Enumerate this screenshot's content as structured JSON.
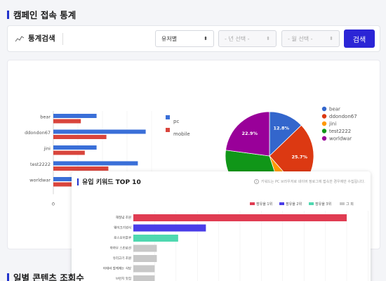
{
  "page": {
    "title": "캠페인 접속 통계",
    "bottom_title": "일별 콘텐츠 조회수"
  },
  "search": {
    "label": "통계검색",
    "user_select": "유저별",
    "year_select": "- 년 선택 -",
    "month_select": "- 월 선택 -",
    "button": "검색"
  },
  "colors": {
    "accent": "#2b25d6",
    "pc": "#3a6fd8",
    "mobile": "#d9453c"
  },
  "chart_data": [
    {
      "type": "bar",
      "orientation": "horizontal",
      "categories": [
        "bear",
        "ddondon67",
        "jini",
        "test2222",
        "worldwar"
      ],
      "series": [
        {
          "name": "pc",
          "values": [
            22,
            47,
            22,
            43,
            20
          ],
          "color": "#3a6fd8"
        },
        {
          "name": "mobile",
          "values": [
            14,
            27,
            16,
            28,
            13
          ],
          "color": "#d9453c"
        }
      ],
      "xlim": [
        0,
        50
      ],
      "tick_labels": [
        "0"
      ],
      "legend": "right"
    },
    {
      "type": "pie",
      "slices": [
        {
          "name": "bear",
          "value": 12.8,
          "label": "12.8%",
          "color": "#3366cc"
        },
        {
          "name": "ddondon67",
          "value": 25.7,
          "label": "25.7%",
          "color": "#dc3912"
        },
        {
          "name": "jini",
          "value": 6.5,
          "label": "",
          "color": "#ff9900"
        },
        {
          "name": "test2222",
          "value": 32.1,
          "label": "",
          "color": "#109618"
        },
        {
          "name": "worldwar",
          "value": 22.9,
          "label": "22.9%",
          "color": "#990099"
        }
      ],
      "legend": "right"
    },
    {
      "type": "bar",
      "orientation": "horizontal",
      "title": "유입 키워드 TOP 10",
      "note": "키워드는 PC 브라우저로 네이버 정로그에 접속한 경우에만 수집됩니다.",
      "categories": [
        "해질녘 조원",
        "웨이크기념식",
        "로스모어후쿠",
        "까까우 스킨로션",
        "유리고기 조원",
        "아데바 할케재는 식당",
        "브런치 맛집"
      ],
      "values": [
        100,
        34,
        21,
        11,
        11,
        10,
        10
      ],
      "colors": [
        "#e03c52",
        "#4a3de8",
        "#4fd8b0",
        "#c8c8c8",
        "#c8c8c8",
        "#c8c8c8",
        "#c8c8c8"
      ],
      "legend_items": [
        {
          "name": "점유율 1위",
          "color": "#e03c52"
        },
        {
          "name": "점유율 2위",
          "color": "#4a3de8"
        },
        {
          "name": "점유율 3위",
          "color": "#4fd8b0"
        },
        {
          "name": "그 외",
          "color": "#c8c8c8"
        }
      ]
    }
  ]
}
